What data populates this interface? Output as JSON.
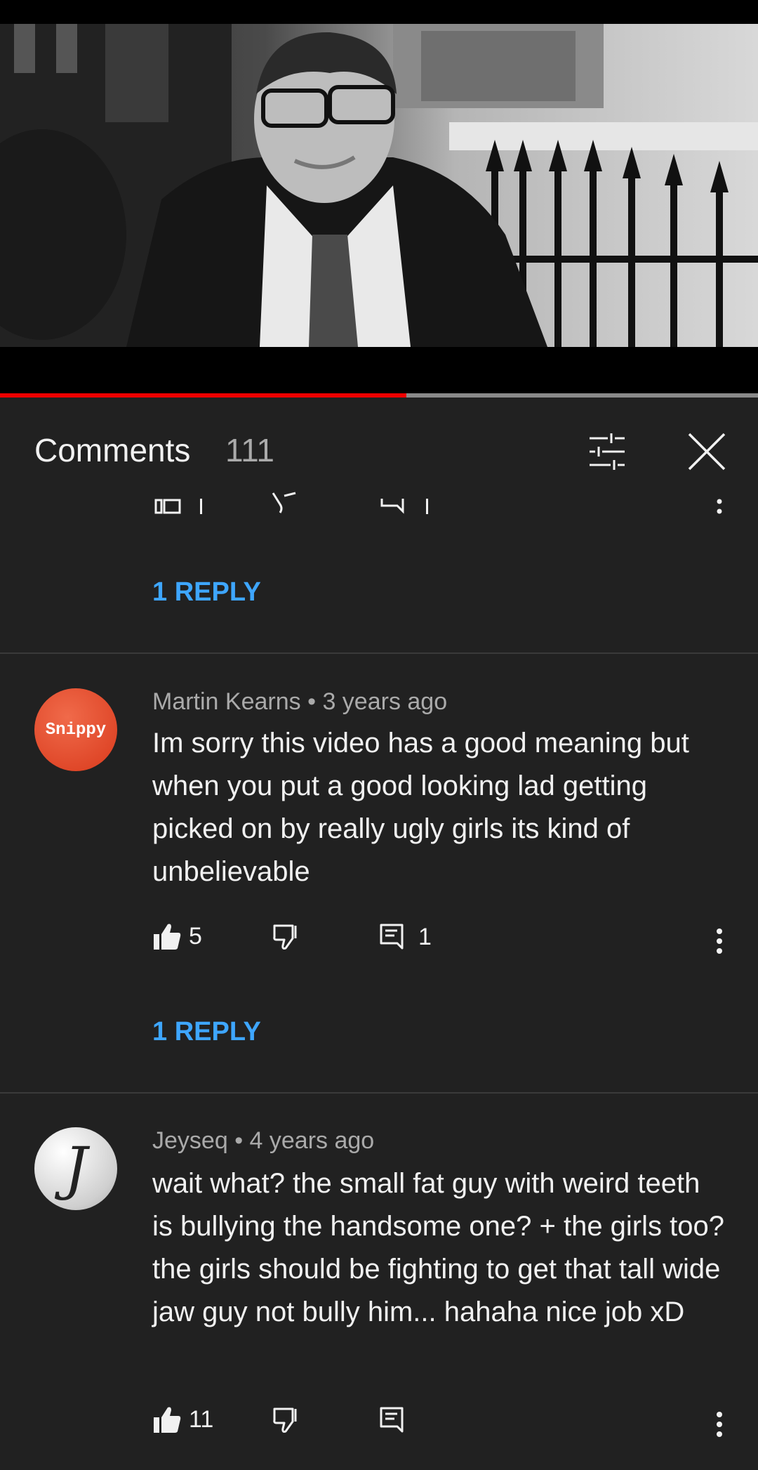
{
  "header": {
    "title": "Comments",
    "count": "111"
  },
  "video": {
    "progress_fraction": 0.536
  },
  "comments": [
    {
      "reply_label": "1 REPLY"
    },
    {
      "author": "Martin Kearns",
      "time": "3 years ago",
      "avatar_text": "Snippy",
      "text": "Im sorry this video has a good meaning but when you put a good looking lad getting picked on by really ugly girls its kind of unbelievable",
      "likes": "5",
      "replies_count": "1",
      "reply_label": "1 REPLY"
    },
    {
      "author": "Jeyseq",
      "time": "4 years ago",
      "avatar_text": "J",
      "text": "wait what? the small fat guy with weird teeth is bullying the handsome one? + the girls too? the girls should be fighting to get that tall wide jaw guy not bully him... hahaha nice job xD",
      "likes": "11"
    }
  ],
  "separator": "•",
  "colors": {
    "background": "#212121",
    "link": "#3ea6ff",
    "progress": "#ee0000",
    "avatar_snippy": "#e8452a"
  },
  "icons": {
    "like": "thumbs-up-icon",
    "dislike": "thumbs-down-icon",
    "reply": "comment-icon",
    "more": "more-vertical-icon",
    "filter": "sliders-icon",
    "close": "close-icon"
  }
}
